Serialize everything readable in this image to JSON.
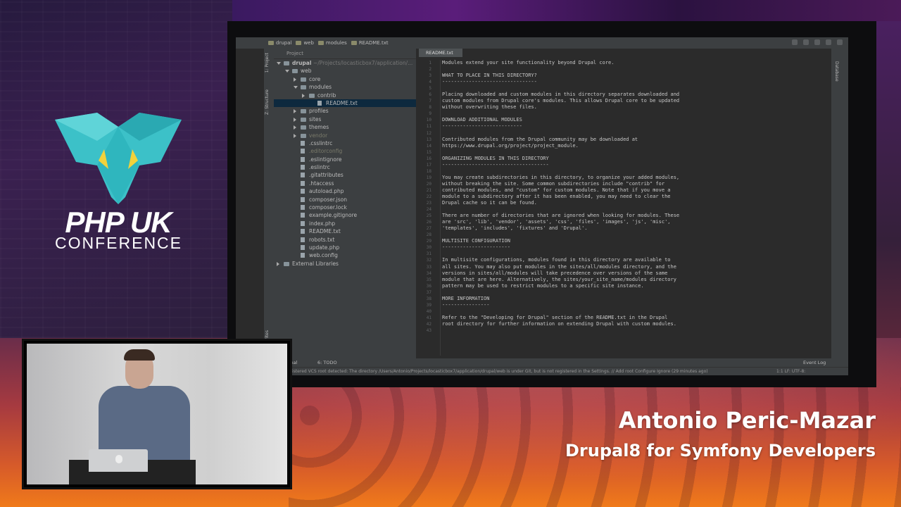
{
  "branding": {
    "logo_title": "PHP UK",
    "logo_subtitle": "CONFERENCE",
    "colors": {
      "teal": "#3cc1c8",
      "yellow": "#f2d23b",
      "white": "#ffffff"
    }
  },
  "speaker": {
    "name": "Antonio Peric-Mazar",
    "talk_title": "Drupal8 for Symfony Developers"
  },
  "ide": {
    "breadcrumbs": [
      "drupal",
      "web",
      "modules",
      "README.txt"
    ],
    "project_label": "Project",
    "left_strip": [
      "1: Project",
      "Z: Structure",
      "Favorites"
    ],
    "right_strip_label": "Database",
    "editor_tab": "README.txt",
    "tree": [
      {
        "label": "drupal",
        "path": "~/Projects/locasticbox7/application/...",
        "depth": 0,
        "open": true,
        "type": "folder"
      },
      {
        "label": "web",
        "depth": 1,
        "open": true,
        "type": "folder"
      },
      {
        "label": "core",
        "depth": 2,
        "open": false,
        "type": "folder"
      },
      {
        "label": "modules",
        "depth": 2,
        "open": true,
        "type": "folder"
      },
      {
        "label": "contrib",
        "depth": 3,
        "open": false,
        "type": "folder"
      },
      {
        "label": "README.txt",
        "depth": 4,
        "type": "file",
        "selected": true
      },
      {
        "label": "profiles",
        "depth": 2,
        "open": false,
        "type": "folder"
      },
      {
        "label": "sites",
        "depth": 2,
        "open": false,
        "type": "folder"
      },
      {
        "label": "themes",
        "depth": 2,
        "open": false,
        "type": "folder"
      },
      {
        "label": "vendor",
        "depth": 2,
        "open": false,
        "type": "folder",
        "dim": true
      },
      {
        "label": ".csslintrc",
        "depth": 2,
        "type": "file"
      },
      {
        "label": ".editorconfig",
        "depth": 2,
        "type": "file",
        "dim": true
      },
      {
        "label": ".eslintignore",
        "depth": 2,
        "type": "file"
      },
      {
        "label": ".eslintrc",
        "depth": 2,
        "type": "file"
      },
      {
        "label": ".gitattributes",
        "depth": 2,
        "type": "file"
      },
      {
        "label": ".htaccess",
        "depth": 2,
        "type": "file"
      },
      {
        "label": "autoload.php",
        "depth": 2,
        "type": "file"
      },
      {
        "label": "composer.json",
        "depth": 2,
        "type": "file"
      },
      {
        "label": "composer.lock",
        "depth": 2,
        "type": "file"
      },
      {
        "label": "example.gitignore",
        "depth": 2,
        "type": "file"
      },
      {
        "label": "index.php",
        "depth": 2,
        "type": "file"
      },
      {
        "label": "README.txt",
        "depth": 2,
        "type": "file"
      },
      {
        "label": "robots.txt",
        "depth": 2,
        "type": "file"
      },
      {
        "label": "update.php",
        "depth": 2,
        "type": "file"
      },
      {
        "label": "web.config",
        "depth": 2,
        "type": "file"
      },
      {
        "label": "External Libraries",
        "depth": 0,
        "open": false,
        "type": "folder"
      }
    ],
    "code_lines": [
      "Modules extend your site functionality beyond Drupal core.",
      "",
      "WHAT TO PLACE IN THIS DIRECTORY?",
      "--------------------------------",
      "",
      "Placing downloaded and custom modules in this directory separates downloaded and",
      "custom modules from Drupal core's modules. This allows Drupal core to be updated",
      "without overwriting these files.",
      "",
      "DOWNLOAD ADDITIONAL MODULES",
      "---------------------------",
      "",
      "Contributed modules from the Drupal community may be downloaded at",
      "https://www.drupal.org/project/project_module.",
      "",
      "ORGANIZING MODULES IN THIS DIRECTORY",
      "------------------------------------",
      "",
      "You may create subdirectories in this directory, to organize your added modules,",
      "without breaking the site. Some common subdirectories include \"contrib\" for",
      "contributed modules, and \"custom\" for custom modules. Note that if you move a",
      "module to a subdirectory after it has been enabled, you may need to clear the",
      "Drupal cache so it can be found.",
      "",
      "There are number of directories that are ignored when looking for modules. These",
      "are 'src', 'lib', 'vendor', 'assets', 'css', 'files', 'images', 'js', 'misc',",
      "'templates', 'includes', 'fixtures' and 'Drupal'.",
      "",
      "MULTISITE CONFIGURATION",
      "-----------------------",
      "",
      "In multisite configurations, modules found in this directory are available to",
      "all sites. You may also put modules in the sites/all/modules directory, and the",
      "versions in sites/all/modules will take precedence over versions of the same",
      "module that are here. Alternatively, the sites/your_site_name/modules directory",
      "pattern may be used to restrict modules to a specific site instance.",
      "",
      "MORE INFORMATION",
      "----------------",
      "",
      "Refer to the \"Developing for Drupal\" section of the README.txt in the Drupal",
      "root directory for further information on extending Drupal with custom modules.",
      ""
    ],
    "bottom_tabs": [
      "Terminal",
      "6: TODO"
    ],
    "event_log": "Event Log",
    "status_message": "Unregistered VCS root detected: The directory /Users/Antonio/Projects/locasticbox7/application/drupal/web is under Git, but is not registered in the Settings. // Add root  Configure  Ignore (29 minutes ago)",
    "status_right": "1:1  LF:  UTF-8:"
  }
}
